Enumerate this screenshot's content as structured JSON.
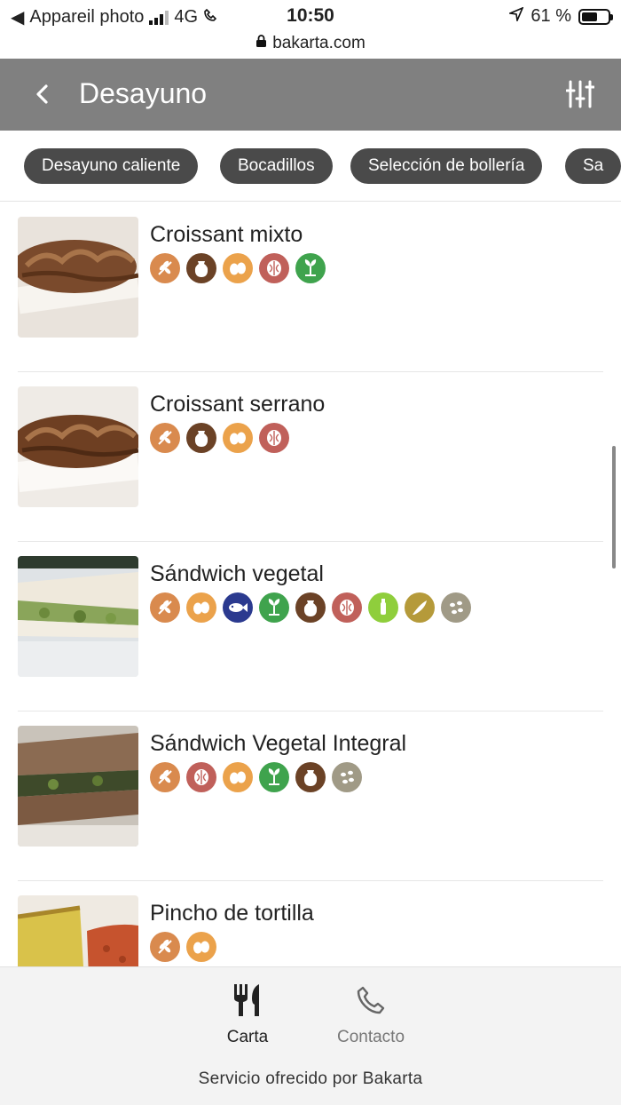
{
  "status_bar": {
    "carrier": "Appareil photo",
    "network": "4G",
    "time": "10:50",
    "battery": "61 %",
    "battery_level": 0.61
  },
  "browser": {
    "url": "bakarta.com"
  },
  "header": {
    "title": "Desayuno"
  },
  "categories": [
    {
      "label": "Desayuno caliente"
    },
    {
      "label": "Bocadillos"
    },
    {
      "label": "Selección de bollería"
    },
    {
      "label": "Sa"
    }
  ],
  "items": [
    {
      "name": "Croissant mixto",
      "allergens": [
        "gluten",
        "milk",
        "eggs",
        "nuts",
        "celery"
      ]
    },
    {
      "name": "Croissant serrano",
      "allergens": [
        "gluten",
        "milk",
        "eggs",
        "nuts"
      ]
    },
    {
      "name": "Sándwich vegetal",
      "allergens": [
        "gluten",
        "eggs",
        "fish",
        "celery",
        "milk",
        "nuts",
        "mustard",
        "sesame-oil",
        "soy"
      ]
    },
    {
      "name": "Sándwich Vegetal Integral",
      "allergens": [
        "gluten",
        "nuts",
        "eggs",
        "celery",
        "milk",
        "soy"
      ]
    },
    {
      "name": "Pincho de tortilla",
      "allergens": [
        "gluten",
        "eggs"
      ]
    }
  ],
  "allergen_colors": {
    "gluten": "#d98a4e",
    "milk": "#6b4226",
    "eggs": "#eba24b",
    "nuts": "#c0605a",
    "celery": "#3fa34d",
    "fish": "#2b3a8f",
    "mustard": "#8fce3c",
    "sesame-oil": "#b59a3a",
    "soy": "#a09a86"
  },
  "bottom_nav": {
    "menu_label": "Carta",
    "contact_label": "Contacto",
    "footer": "Servicio ofrecido por Bakarta"
  }
}
